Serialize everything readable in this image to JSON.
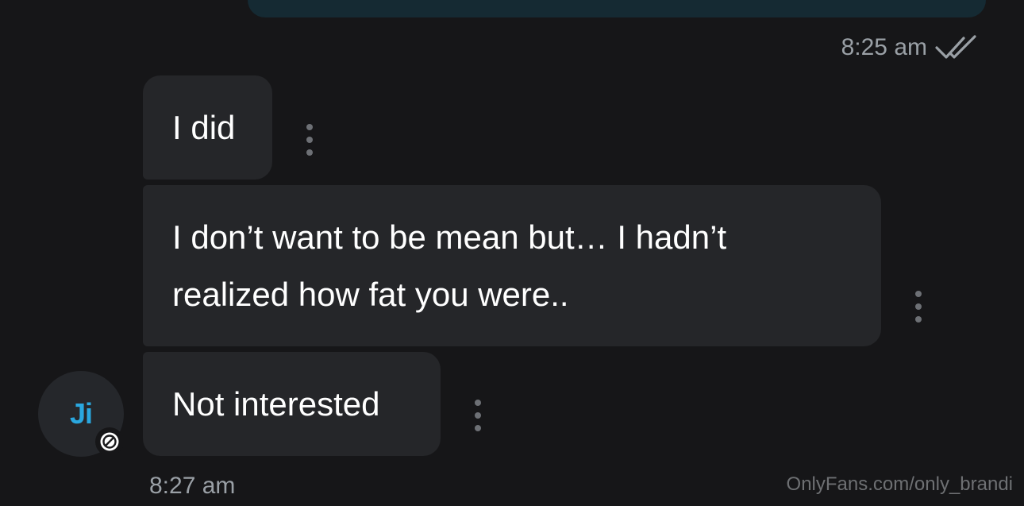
{
  "sent_message": {
    "time": "8:25 am",
    "status_icon": "double-check-icon"
  },
  "messages": [
    {
      "text": "I did",
      "menu_icon": "more-vertical-icon"
    },
    {
      "text_lines": [
        "I don’t want to be mean but… I hadn’t",
        "realized how fat you were.."
      ],
      "menu_icon": "more-vertical-icon"
    },
    {
      "text": "Not interested",
      "menu_icon": "more-vertical-icon"
    }
  ],
  "sender": {
    "initials": "Ji",
    "status_icon": "blocked-icon"
  },
  "received_time": "8:27 am",
  "watermark": "OnlyFans.com/only_brandi",
  "colors": {
    "background": "#161618",
    "bubble": "#252629",
    "sent_bubble": "#152a33",
    "avatar_text": "#2aa7df",
    "muted_text": "#9aa0a6"
  }
}
